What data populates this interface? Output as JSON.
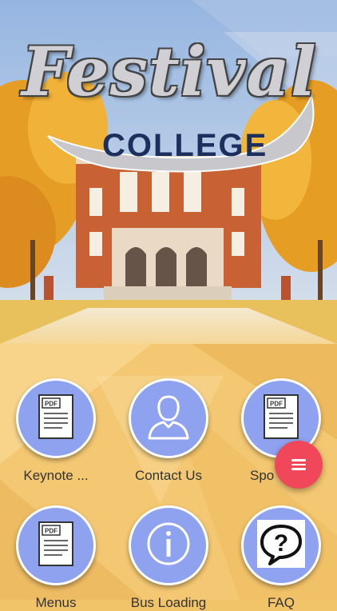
{
  "header": {
    "title_script": "Festival",
    "title_banner": "COLLEGE"
  },
  "tiles": [
    {
      "label": "Keynote ...",
      "icon": "pdf-document-icon"
    },
    {
      "label": "Contact Us",
      "icon": "person-icon"
    },
    {
      "label": "Spo",
      "icon": "pdf-document-icon"
    },
    {
      "label": "Menus",
      "icon": "pdf-document-icon"
    },
    {
      "label": "Bus Loading",
      "icon": "info-icon"
    },
    {
      "label": "FAQ",
      "icon": "question-speech-bubble-icon"
    }
  ],
  "fab": {
    "icon": "menu-icon"
  },
  "pdf_badge": "PDF",
  "colors": {
    "tile_circle": "#8fa2f0",
    "fab": "#f0485a",
    "background": "#f2c46a",
    "banner_text": "#1d2f5c"
  }
}
